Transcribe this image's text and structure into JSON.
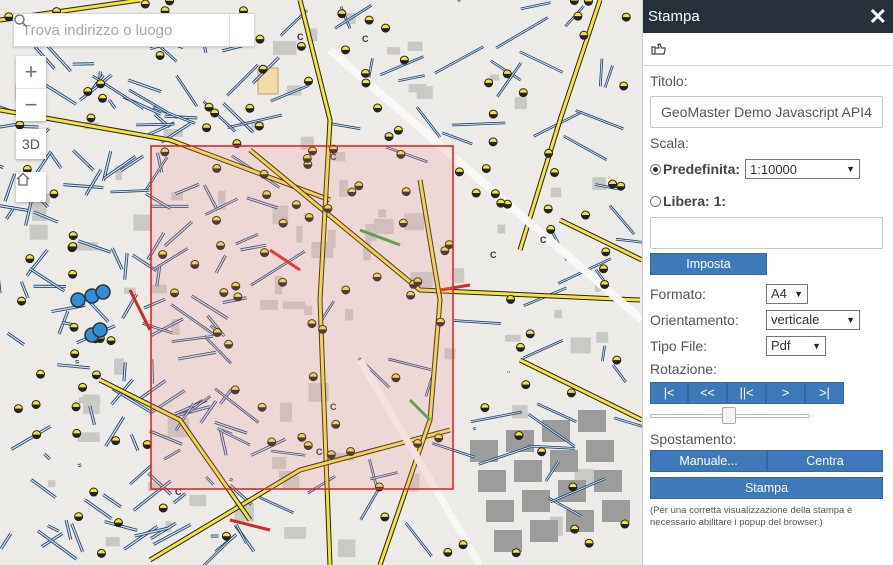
{
  "map": {
    "search_placeholder": "Trova indirizzo o luogo",
    "zoom_in": "+",
    "zoom_out": "−",
    "btn_3d": "3D",
    "road_label": "C"
  },
  "panel": {
    "title": "Stampa",
    "close": "✕",
    "titolo_label": "Titolo:",
    "titolo_value": "GeoMaster Demo Javascript API4",
    "scala_label": "Scala:",
    "predefinita_label": "Predefinita:",
    "scale_value": "1:10000",
    "libera_label": "Libera: 1:",
    "libera_value": "",
    "imposta_button": "Imposta",
    "formato_label": "Formato:",
    "formato_value": "A4",
    "orientamento_label": "Orientamento:",
    "orientamento_value": "verticale",
    "tipo_label": "Tipo File:",
    "tipo_value": "Pdf",
    "rotazione_label": "Rotazione:",
    "rot_buttons": [
      "|<",
      "<<",
      "||<",
      ">",
      ">|"
    ],
    "spostamento_label": "Spostamento:",
    "manuale_button": "Manuale...",
    "centra_button": "Centra",
    "stampa_button": "Stampa",
    "note": "(Per una corretta visualizzazione della stampa è necessario abilitare i popup del browser.)"
  },
  "colors": {
    "accent": "#3e7ab9",
    "header": "#27313c",
    "print_area_border": "#e0252b",
    "major_road": "#f7e338",
    "network_line": "#1f3f66"
  }
}
